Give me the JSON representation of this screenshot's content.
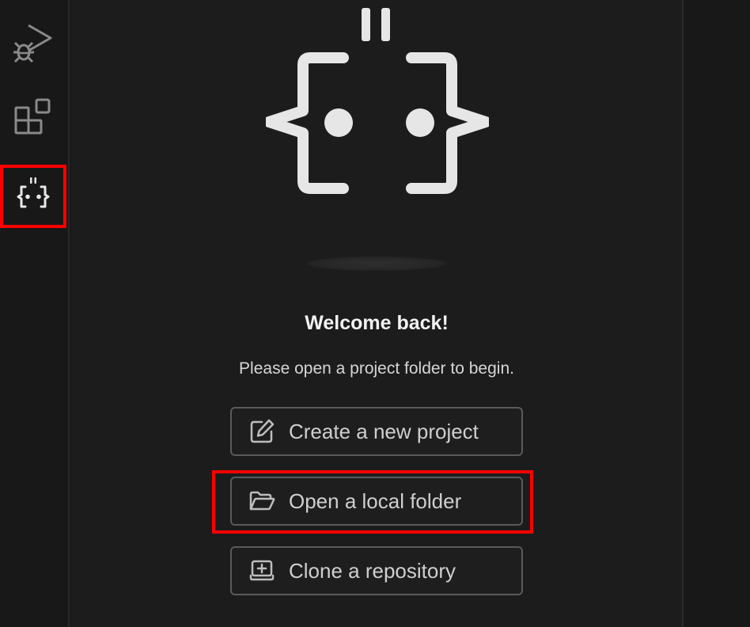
{
  "activity_bar": {
    "items": [
      {
        "name": "run-and-debug",
        "icon": "run-debug-icon",
        "selected": false
      },
      {
        "name": "extensions",
        "icon": "extensions-icon",
        "selected": false
      },
      {
        "name": "assistant",
        "icon": "curly-face-icon",
        "selected": true
      }
    ]
  },
  "welcome": {
    "title": "Welcome back!",
    "subtitle": "Please open a project folder to begin.",
    "buttons": {
      "create": {
        "label": "Create a new project",
        "icon": "edit-icon"
      },
      "open": {
        "label": "Open a local folder",
        "icon": "folder-open-icon"
      },
      "clone": {
        "label": "Clone a repository",
        "icon": "repo-clone-icon"
      }
    }
  },
  "colors": {
    "background": "#1c1c1c",
    "sidebar": "#181818",
    "highlight": "#ff0000",
    "button_border": "#5a5a5a",
    "text": "#cfcfcf"
  }
}
